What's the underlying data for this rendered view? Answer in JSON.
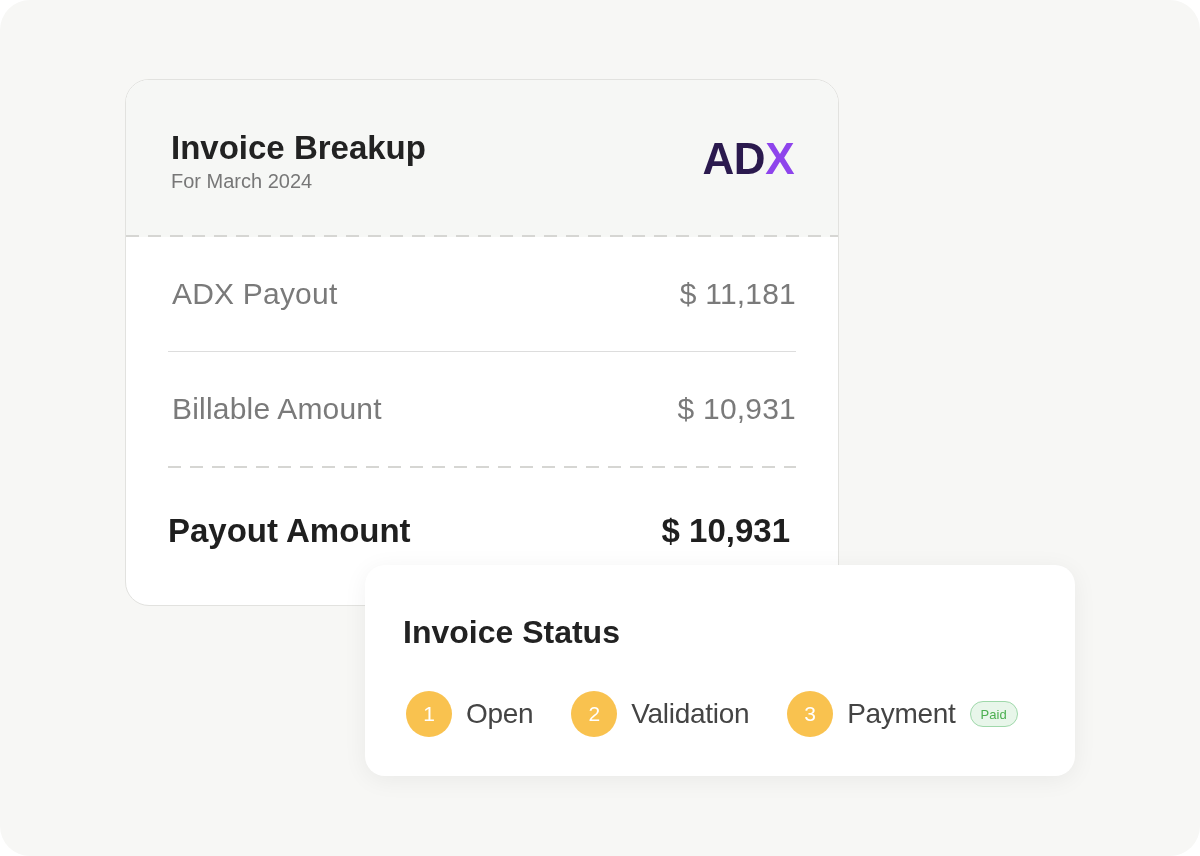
{
  "breakup_card": {
    "title": "Invoice Breakup",
    "subtitle": "For March 2024",
    "logo": {
      "text": "AD",
      "accent": "X"
    },
    "rows": [
      {
        "kind": "item",
        "label": "ADX Payout",
        "value": "$ 11,181"
      },
      {
        "kind": "item",
        "label": "Billable Amount",
        "value": "$ 10,931"
      },
      {
        "kind": "total",
        "label": "Payout Amount",
        "value": "$ 10,931"
      }
    ]
  },
  "status_card": {
    "title": "Invoice Status",
    "steps": [
      {
        "number": "1",
        "label": "Open"
      },
      {
        "number": "2",
        "label": "Validation"
      },
      {
        "number": "3",
        "label": "Payment",
        "badge": "Paid"
      }
    ]
  }
}
